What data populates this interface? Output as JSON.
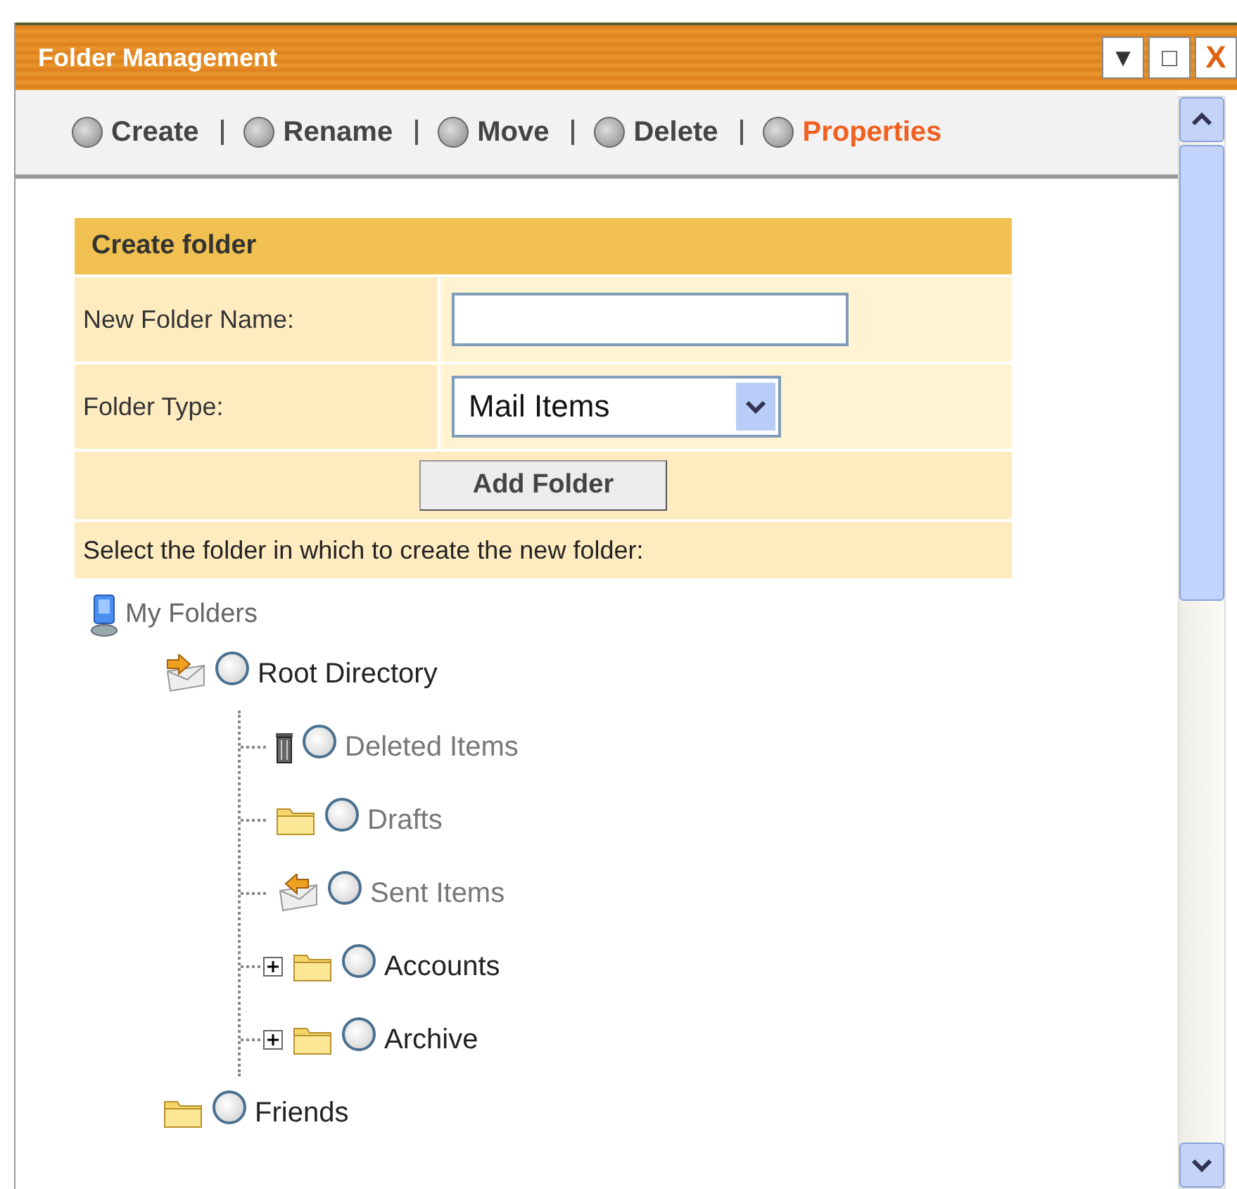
{
  "window": {
    "title": "Folder Management",
    "controls": [
      {
        "kind": "menu",
        "label": "▼"
      },
      {
        "kind": "maximize",
        "label": "□"
      },
      {
        "kind": "close",
        "label": "X"
      }
    ]
  },
  "toolbar": [
    {
      "label": "Create",
      "selected": false
    },
    {
      "label": "Rename",
      "selected": false
    },
    {
      "label": "Move",
      "selected": false
    },
    {
      "label": "Delete",
      "selected": false
    },
    {
      "label": "Properties",
      "selected": true
    }
  ],
  "form": {
    "title": "Create folder",
    "name_label": "New Folder Name:",
    "type_label": "Folder Type:",
    "type_value": "Mail Items",
    "button": "Add Folder",
    "hint": "Select the folder in which to create the new folder:"
  },
  "tree": {
    "label": "My Folders",
    "children": [
      {
        "label": "Root Directory",
        "kind": "root",
        "dimmed": false,
        "selected": false,
        "children": [
          {
            "label": "Deleted Items",
            "kind": "trash",
            "dimmed": true,
            "selected": false
          },
          {
            "label": "Drafts",
            "kind": "folder",
            "dimmed": true,
            "selected": false
          },
          {
            "label": "Sent Items",
            "kind": "sent",
            "dimmed": true,
            "selected": false
          },
          {
            "label": "Accounts",
            "kind": "folder",
            "dimmed": false,
            "selected": false,
            "expanded": false
          },
          {
            "label": "Archive",
            "kind": "folder",
            "dimmed": false,
            "selected": false,
            "expanded": false
          }
        ]
      },
      {
        "label": "Friends",
        "kind": "folder",
        "dimmed": false,
        "selected": false
      }
    ]
  }
}
